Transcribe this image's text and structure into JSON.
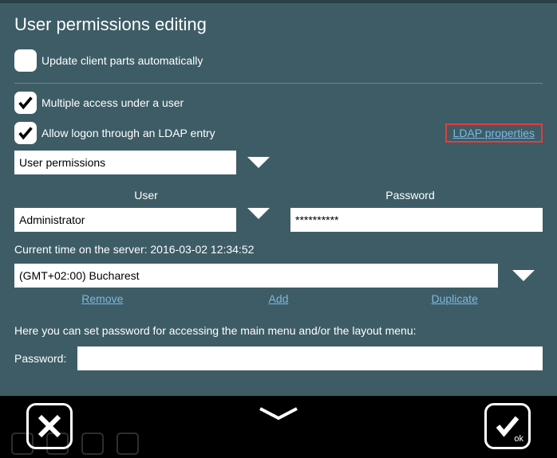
{
  "title": "User permissions editing",
  "checkboxes": {
    "update_auto": {
      "label": "Update client parts automatically",
      "checked": false
    },
    "multiple_access": {
      "label": "Multiple access under a user",
      "checked": true
    },
    "allow_ldap": {
      "label": "Allow logon through an LDAP entry",
      "checked": true
    }
  },
  "ldap_link": "LDAP properties",
  "permissions_select": "User permissions",
  "columns": {
    "user": "User",
    "password": "Password"
  },
  "user_value": "Administrator",
  "password_value": "**********",
  "server_time_label": "Current time on the server: 2016-03-02 12:34:52",
  "timezone_value": "(GMT+02:00) Bucharest",
  "actions": {
    "remove": "Remove",
    "add": "Add",
    "duplicate": "Duplicate"
  },
  "hint": "Here you can set password for accessing the main menu and/or the layout menu:",
  "password_label": "Password:",
  "ok_label": "ok"
}
